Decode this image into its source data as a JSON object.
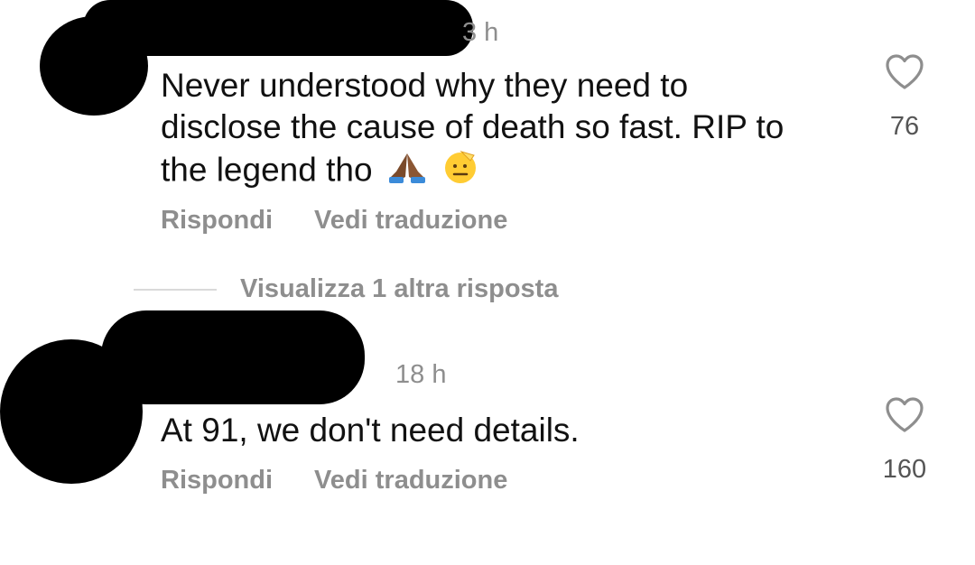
{
  "comments": [
    {
      "time": "3 h",
      "text_lines": [
        "Never understood why they need to",
        "disclose the cause of death so fast. RIP to",
        "the legend tho"
      ],
      "emojis": [
        "folded-hands-icon",
        "saluting-face-icon"
      ],
      "reply_label": "Rispondi",
      "translate_label": "Vedi traduzione",
      "likes": "76"
    },
    {
      "time": "18 h",
      "text_lines": [
        "At 91, we don't need details."
      ],
      "reply_label": "Rispondi",
      "translate_label": "Vedi traduzione",
      "likes": "160"
    }
  ],
  "view_replies_label": "Visualizza 1 altra risposta",
  "colors": {
    "text": "#111111",
    "secondary": "#8e8e8e",
    "redaction": "#000000",
    "divider": "#d9d9d9"
  }
}
